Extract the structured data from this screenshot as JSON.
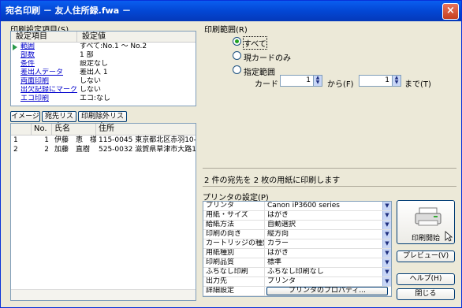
{
  "window": {
    "title": "宛名印刷 － 友人住所録.fwa －",
    "close": "×"
  },
  "settings": {
    "label": "印刷設定項目(S)",
    "headers": [
      "設定項目",
      "設定値"
    ],
    "rows": [
      {
        "key": "範囲",
        "value": "すべて:No.1 ～ No.2",
        "link": true
      },
      {
        "key": "部数",
        "value": "1 部",
        "link": true
      },
      {
        "key": "条件",
        "value": "設定なし",
        "link": true
      },
      {
        "key": "差出人データ",
        "value": "差出人 1",
        "link": true
      },
      {
        "key": "両面印刷",
        "value": "しない",
        "link": true
      },
      {
        "key": "出欠記録にマーク",
        "value": "しない",
        "link": true
      },
      {
        "key": "エコ印刷",
        "value": "エコ:なし",
        "link": true
      }
    ]
  },
  "buttons": {
    "image": "イメージ",
    "dest_list": "宛先リスト",
    "exclude_list": "印刷除外リスト",
    "print_start": "印刷開始",
    "preview": "プレビュー(V)",
    "help": "ヘルプ(H)",
    "close": "閉じる",
    "printer_props": "プリンタのプロパティ..."
  },
  "recipients": {
    "headers": [
      "",
      "No.",
      "氏名",
      "住所"
    ],
    "rows": [
      [
        "1",
        "1",
        "伊藤　恵　様",
        "115-0045 東京都北区赤羽10-"
      ],
      [
        "2",
        "2",
        "加藤　直樹　様",
        "525-0032 滋賀県草津市大路1"
      ]
    ]
  },
  "print_range": {
    "label": "印刷範囲(R)",
    "options": [
      "すべて",
      "現カードのみ",
      "指定範囲"
    ],
    "selected": "すべて",
    "card_label": "カード",
    "from_label": "から(F)",
    "to_label": "まで(T)",
    "from_value": "1",
    "to_value": "1"
  },
  "summary": "2 件の宛先を 2 枚の用紙に印刷します",
  "printer": {
    "label": "プリンタの設定(P)",
    "rows": [
      {
        "key": "プリンタ",
        "value": "Canon iP3600 series"
      },
      {
        "key": "用紙・サイズ",
        "value": "はがき"
      },
      {
        "key": "給紙方法",
        "value": "自動選択"
      },
      {
        "key": "印刷の向き",
        "value": "縦方向"
      },
      {
        "key": "カートリッジの種類",
        "value": "カラー"
      },
      {
        "key": "用紙種別",
        "value": "はがき"
      },
      {
        "key": "印刷品質",
        "value": "標準"
      },
      {
        "key": "ふちなし印刷",
        "value": "ふちなし印刷なし"
      },
      {
        "key": "出力先",
        "value": "プリンタ"
      },
      {
        "key": "詳細設定",
        "value": ""
      }
    ]
  },
  "colors": {
    "title_bar": "#0347d4",
    "dialog_bg": "#ece9d8",
    "link": "#0000cc"
  }
}
